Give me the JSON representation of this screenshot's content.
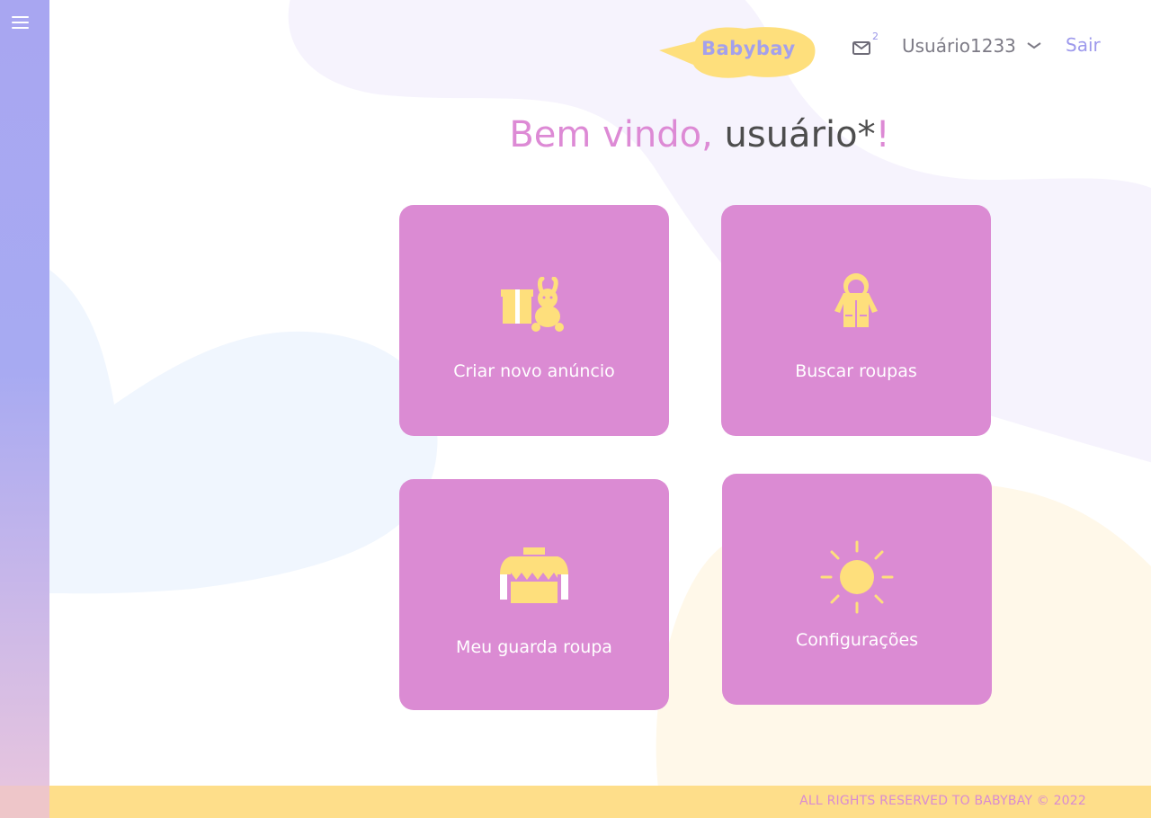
{
  "header": {
    "logo_text": "Babybay",
    "mail_count": "2",
    "username": "Usuário1233",
    "logout_label": "Sair"
  },
  "welcome": {
    "greeting": "Bem vindo, ",
    "user": "usuário*",
    "exclamation": "!"
  },
  "cards": [
    {
      "label": "Criar novo anúncio",
      "icon": "gift-bunny-icon"
    },
    {
      "label": "Buscar roupas",
      "icon": "raincoat-icon"
    },
    {
      "label": "Meu guarda roupa",
      "icon": "sweater-icon"
    },
    {
      "label": "Configurações",
      "icon": "sun-icon"
    }
  ],
  "footer": {
    "text": "ALL RIGHTS RESERVED TO BABYBAY © 2022"
  },
  "colors": {
    "sidebar": "#a8a6f1",
    "card": "#db8bd3",
    "accent_pink": "#dd8ad5",
    "accent_purple": "#9d99ec",
    "icon_yellow": "#fedf7c",
    "footer": "#fede8a"
  }
}
